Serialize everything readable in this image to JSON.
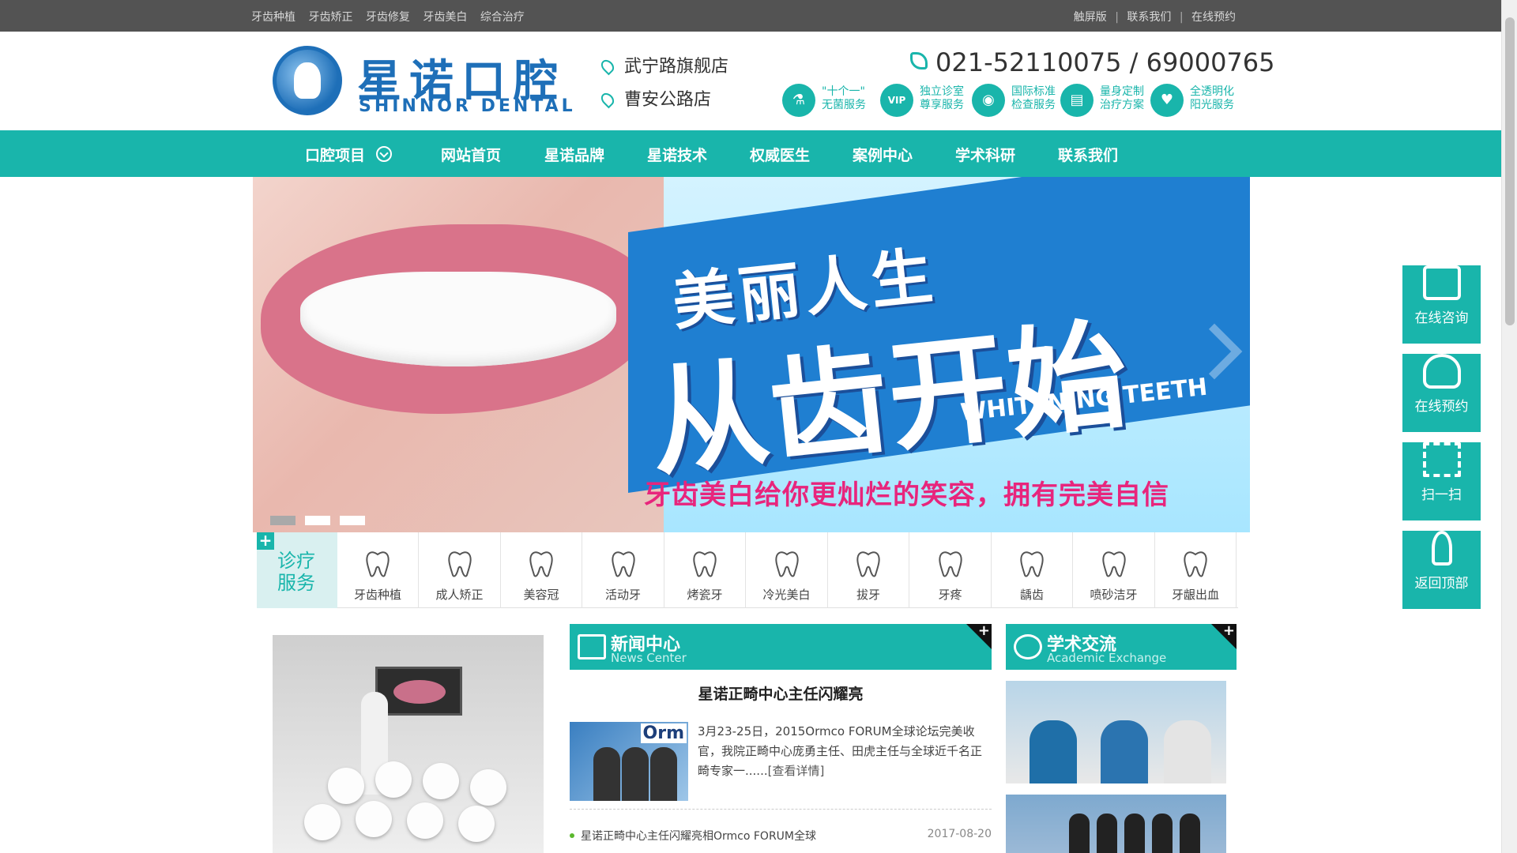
{
  "topbar": {
    "links": [
      "牙齿种植",
      "牙齿矫正",
      "牙齿修复",
      "牙齿美白",
      "综合治疗"
    ],
    "right_links": [
      "触屏版",
      "联系我们",
      "在线预约"
    ],
    "separator": "|"
  },
  "header": {
    "logo_cn": "星诺口腔",
    "logo_en": "SHINNOR DENTAL",
    "branches": [
      "武宁路旗舰店",
      "曹安公路店"
    ],
    "phone": "021-52110075 / 69000765",
    "badges": [
      {
        "icon": "flask-icon",
        "symbol": "⚗",
        "text": "\"十个一\"\n无菌服务"
      },
      {
        "icon": "vip-icon",
        "symbol": "VIP",
        "text": "独立诊室\n尊享服务"
      },
      {
        "icon": "eye-icon",
        "symbol": "◉",
        "text": "国际标准\n检查服务"
      },
      {
        "icon": "document-icon",
        "symbol": "▤",
        "text": "量身定制\n治疗方案"
      },
      {
        "icon": "heart-icon",
        "symbol": "♥",
        "text": "全透明化\n阳光服务"
      }
    ]
  },
  "nav": {
    "items": [
      "口腔项目",
      "网站首页",
      "星诺品牌",
      "星诺技术",
      "权威医生",
      "案例中心",
      "学术科研",
      "联系我们"
    ]
  },
  "banner": {
    "line1": "美丽人生",
    "line2": "从齿开始",
    "line3": "WHITENING TEETH",
    "slogan": "牙齿美白给你更灿烂的笑容，拥有完美自信",
    "active_slide": 1,
    "slide_count": 3
  },
  "services": {
    "label": "诊疗\n服务",
    "items": [
      {
        "label": "牙齿种植",
        "icon": "implant-icon"
      },
      {
        "label": "成人矫正",
        "icon": "adult-braces-icon"
      },
      {
        "label": "美容冠",
        "icon": "crown-icon"
      },
      {
        "label": "活动牙",
        "icon": "denture-icon"
      },
      {
        "label": "烤瓷牙",
        "icon": "porcelain-tooth-icon"
      },
      {
        "label": "冷光美白",
        "icon": "whitening-icon"
      },
      {
        "label": "拔牙",
        "icon": "extraction-icon"
      },
      {
        "label": "牙疼",
        "icon": "toothache-icon"
      },
      {
        "label": "龋齿",
        "icon": "cavity-icon"
      },
      {
        "label": "喷砂洁牙",
        "icon": "cleaning-icon"
      },
      {
        "label": "牙龈出血",
        "icon": "gum-bleeding-icon"
      }
    ]
  },
  "news": {
    "heading_cn": "新闻中心",
    "heading_en": "News Center",
    "featured_title": "星诺正畸中心主任闪耀亮",
    "thumb_brand": "Orm",
    "excerpt": "3月23-25日，2015Ormco FORUM全球论坛完美收官，我院正畸中心庞勇主任、田虎主任与全球近千名正畸专家一......",
    "more": "[查看详情]",
    "list": [
      {
        "title": "星诺正畸中心主任闪耀亮相Ormco FORUM全球",
        "date": "2017-08-20"
      }
    ]
  },
  "academic": {
    "heading_cn": "学术交流",
    "heading_en": "Academic Exchange"
  },
  "float_bar": {
    "items": [
      "在线咨询",
      "在线预约",
      "扫一扫",
      "返回顶部"
    ]
  },
  "colors": {
    "accent": "#19b5ab",
    "topbar": "#535353",
    "brand_blue": "#1e6fb8",
    "slogan_pink": "#e8257c"
  }
}
